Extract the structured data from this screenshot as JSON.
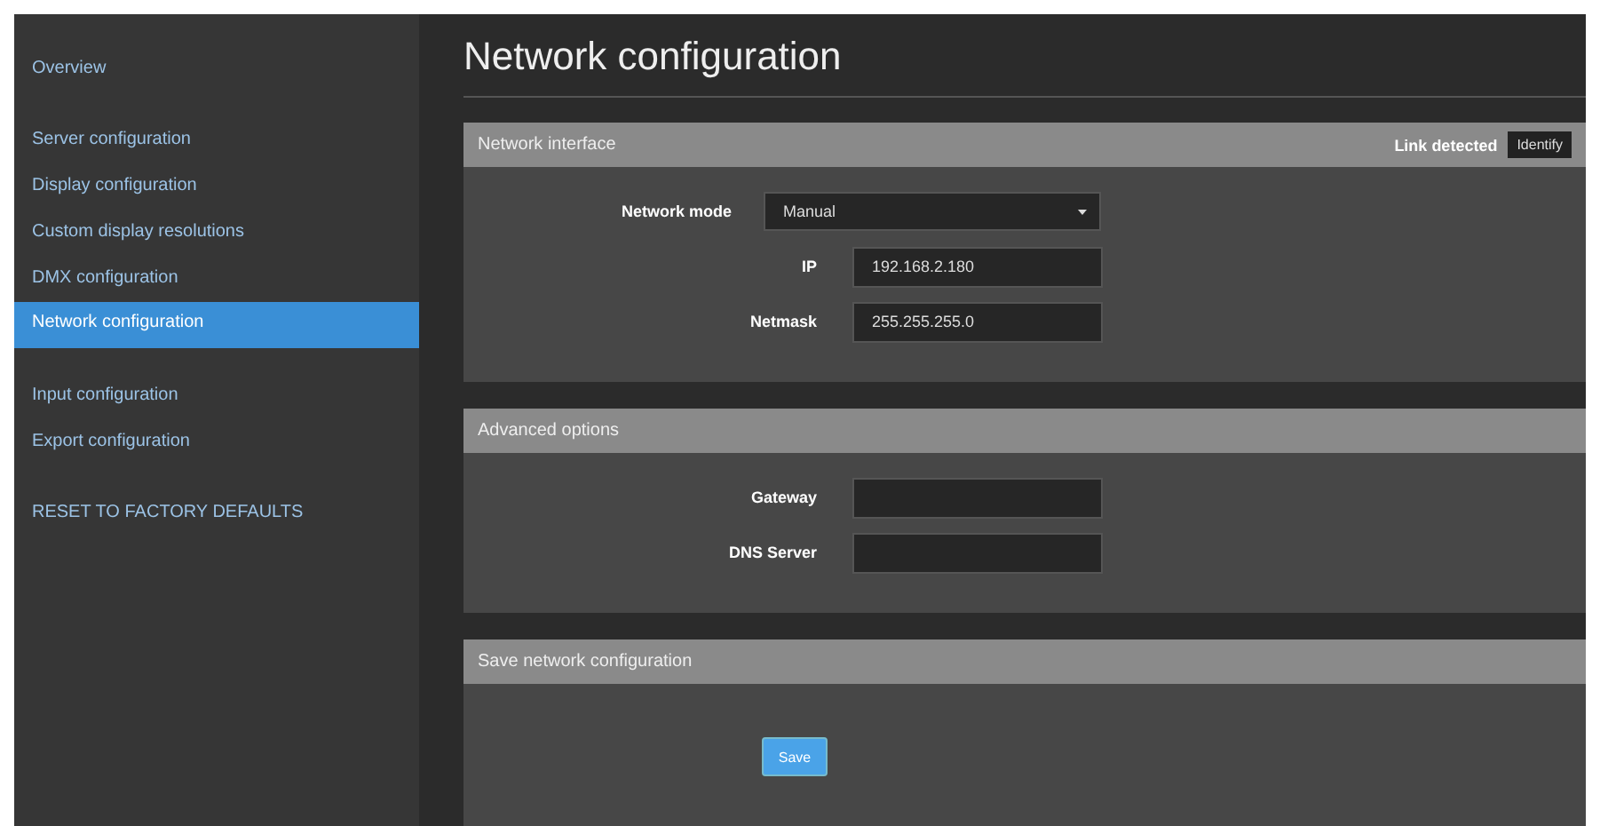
{
  "sidebar": {
    "groups": [
      [
        {
          "label": "Overview",
          "selected": false
        }
      ],
      [
        {
          "label": "Server configuration",
          "selected": false
        },
        {
          "label": "Display configuration",
          "selected": false
        },
        {
          "label": "Custom display resolutions",
          "selected": false
        },
        {
          "label": "DMX configuration",
          "selected": false
        },
        {
          "label": "Network configuration",
          "selected": true
        }
      ],
      [
        {
          "label": "Input configuration",
          "selected": false
        },
        {
          "label": "Export configuration",
          "selected": false
        }
      ],
      [
        {
          "label": "RESET TO FACTORY DEFAULTS",
          "selected": false
        }
      ]
    ]
  },
  "main": {
    "title": "Network configuration",
    "panels": [
      {
        "title": "Network interface",
        "status": "Link detected",
        "status_button": "Identify",
        "rows": [
          {
            "label": "Network mode",
            "kind": "select",
            "value": "Manual"
          },
          {
            "label": "IP",
            "kind": "input",
            "value": "192.168.2.180"
          },
          {
            "label": "Netmask",
            "kind": "input",
            "value": "255.255.255.0"
          }
        ]
      },
      {
        "title": "Advanced options",
        "rows": [
          {
            "label": "Gateway",
            "kind": "input"
          },
          {
            "label": "DNS Server",
            "kind": "input"
          }
        ]
      },
      {
        "title": "Save network configuration",
        "button": "Save"
      }
    ]
  }
}
